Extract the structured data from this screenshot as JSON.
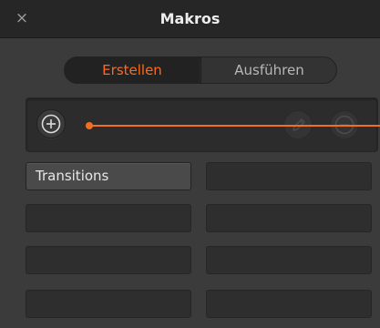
{
  "window": {
    "title": "Makros",
    "close_symbol": "×"
  },
  "tabs": [
    {
      "label": "Erstellen",
      "active": true
    },
    {
      "label": "Ausführen",
      "active": false
    }
  ],
  "toolbar": {
    "add_icon": "plus-circle-icon",
    "edit_icon": "pencil-icon",
    "remove_icon": "minus-circle-icon"
  },
  "macro_slots": [
    {
      "label": "Transitions"
    },
    {
      "label": ""
    },
    {
      "label": ""
    },
    {
      "label": ""
    },
    {
      "label": ""
    },
    {
      "label": ""
    },
    {
      "label": ""
    },
    {
      "label": ""
    }
  ],
  "colors": {
    "accent": "#ff6a1a",
    "callout": "#f26f22",
    "background": "#3b3b3b",
    "titlebar": "#262626"
  }
}
